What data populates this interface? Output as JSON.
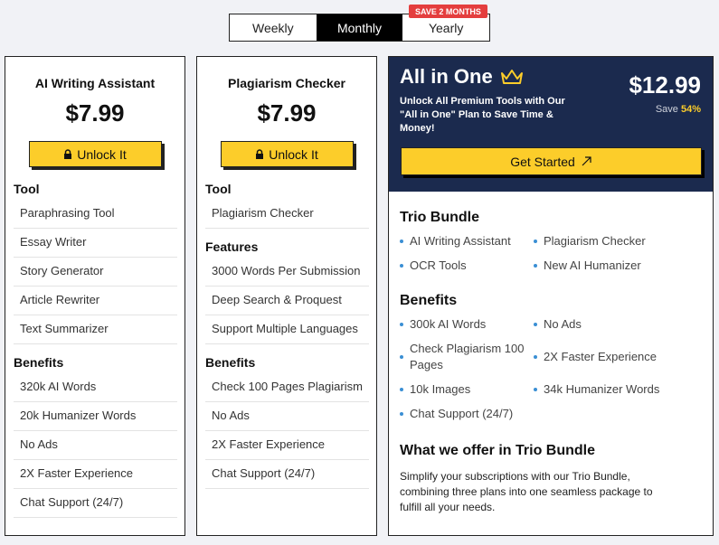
{
  "billing": {
    "options": [
      "Weekly",
      "Monthly",
      "Yearly"
    ],
    "active": "Monthly",
    "badge": "SAVE 2 MONTHS"
  },
  "plans": [
    {
      "name": "AI Writing Assistant",
      "price": "$7.99",
      "cta": "Unlock It",
      "sections": [
        {
          "title": "Tool",
          "items": [
            "Paraphrasing Tool",
            "Essay Writer",
            "Story Generator",
            "Article Rewriter",
            "Text Summarizer"
          ]
        },
        {
          "title": "Benefits",
          "items": [
            "320k AI Words",
            "20k Humanizer Words",
            "No Ads",
            "2X Faster Experience",
            "Chat Support (24/7)"
          ]
        }
      ]
    },
    {
      "name": "Plagiarism Checker",
      "price": "$7.99",
      "cta": "Unlock It",
      "sections": [
        {
          "title": "Tool",
          "items": [
            "Plagiarism Checker"
          ]
        },
        {
          "title": "Features",
          "items": [
            "3000 Words Per Submission",
            "Deep Search & Proquest",
            "Support Multiple Languages"
          ]
        },
        {
          "title": "Benefits",
          "items": [
            "Check 100 Pages Plagiarism",
            "No Ads",
            "2X Faster Experience",
            "Chat Support (24/7)"
          ]
        }
      ]
    }
  ],
  "all_in_one": {
    "title": "All in One",
    "description": "Unlock All Premium Tools with Our \"All in One\" Plan to Save Time & Money!",
    "price": "$12.99",
    "save_label": "Save",
    "save_value": "54%",
    "cta": "Get Started",
    "bundle_title": "Trio Bundle",
    "bundle_items": [
      "AI Writing Assistant",
      "Plagiarism Checker",
      "OCR Tools",
      "New AI Humanizer"
    ],
    "benefits_title": "Benefits",
    "benefits": [
      "300k AI Words",
      "No Ads",
      "Check Plagiarism 100 Pages",
      "2X Faster Experience",
      "10k Images",
      "34k Humanizer Words",
      "Chat Support (24/7)"
    ],
    "offer_title": "What we offer in Trio Bundle",
    "offer_text": "Simplify your subscriptions with our Trio Bundle, combining three plans into one seamless package to fulfill all your needs."
  },
  "colors": {
    "accent_yellow": "#fccd2a",
    "navy": "#1b2a4e",
    "bullet_blue": "#3a8fd4",
    "badge_red": "#e43e3e"
  },
  "icons": [
    "lock-icon",
    "crown-icon",
    "external-link-icon"
  ]
}
